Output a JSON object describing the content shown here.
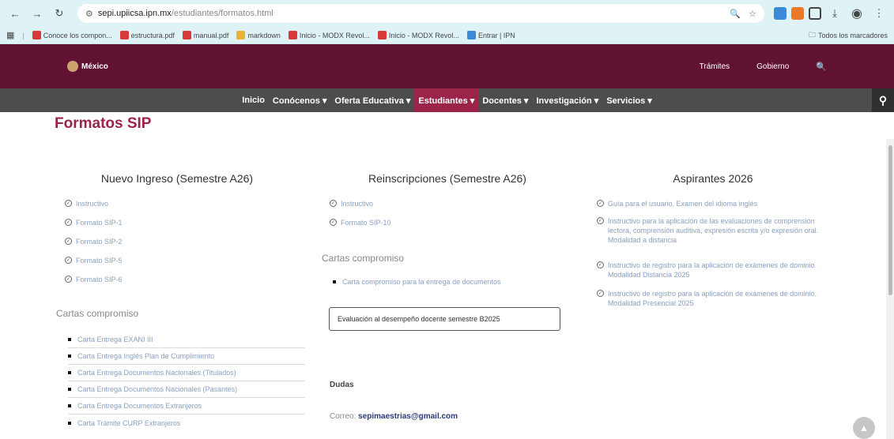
{
  "browser": {
    "url_host": "sepi.upiicsa.ipn.mx",
    "url_path": "/estudiantes/formatos.html",
    "nav_back": "←",
    "nav_forward": "→",
    "nav_reload": "↻",
    "zoom_icon": "🔍",
    "star_icon": "☆",
    "download_icon": "⤓",
    "menu_icon": "⋮",
    "bookmarks": [
      {
        "label": "Conoce los compon...",
        "color": "#d83a3a"
      },
      {
        "label": "estructura.pdf",
        "color": "#d83a3a"
      },
      {
        "label": "manual.pdf",
        "color": "#d83a3a"
      },
      {
        "label": "markdown",
        "color": "#e8b23a"
      },
      {
        "label": "Inicio - MODX Revol...",
        "color": "#d83a3a"
      },
      {
        "label": "Inicio - MODX Revol...",
        "color": "#d83a3a"
      },
      {
        "label": "Entrar | IPN",
        "color": "#3a8ad8"
      }
    ],
    "all_bookmarks": "Todos los marcadores"
  },
  "site": {
    "logo_text": "México",
    "gov_links": [
      "Trámites",
      "Gobierno"
    ],
    "search_icon": "🔍",
    "nav": [
      {
        "label": "Inicio",
        "active": false
      },
      {
        "label": "Conócenos ▾",
        "active": false
      },
      {
        "label": "Oferta Educativa ▾",
        "active": false
      },
      {
        "label": "Estudiantes ▾",
        "active": true
      },
      {
        "label": "Docentes ▾",
        "active": false
      },
      {
        "label": "Investigación ▾",
        "active": false
      },
      {
        "label": "Servicios ▾",
        "active": false
      }
    ]
  },
  "page": {
    "title": "Formatos SIP",
    "col1": {
      "title": "Nuevo Ingreso (Semestre A26)",
      "items": [
        "Instructivo",
        "Formato SIP-1",
        "Formato SIP-2",
        "Formato SIP-5",
        "Formato SIP-6"
      ],
      "section": "Cartas compromiso",
      "cartas": [
        "Carta Entrega EXANI III",
        "Carta Entrega Inglés Plan de Cumplimiento",
        "Carta Entrega Documentos Nacionales (Titulados)",
        "Carta Entrega Documentos Nacionales (Pasantes)",
        "Carta Entrega Documentos Extranjeros",
        "Carta Trámite CURP Extranjeros"
      ]
    },
    "col2": {
      "title": "Reinscripciones (Semestre A26)",
      "items": [
        "Instructivo",
        "Formato SIP-10"
      ],
      "section": "Cartas compromiso",
      "cartas": [
        "Carta compromiso para la entrega de documentos"
      ],
      "button": "Evaluación al desempeño docente semestre B2025",
      "dudas": "Dudas",
      "correo_label": "Correo:",
      "correo_email": "sepimaestrias@gmail.com"
    },
    "col3": {
      "title": "Aspirantes 2026",
      "items": [
        "Guía para el usuario. Examen del idioma inglés",
        "Instructivo para la aplicación de las evaluaciones de comprensión lectora, comprensión auditiva, expresión escrita y/o expresión oral. Modalidad a distancia",
        "Instructivo de registro para la aplicación de exámenes de dominio. Modalidad Distancia 2025",
        "Instructivo de registro para la aplicación de exámenes de dominio. Modalidad Presencial 2025"
      ]
    },
    "scroll_top_icon": "▲"
  }
}
